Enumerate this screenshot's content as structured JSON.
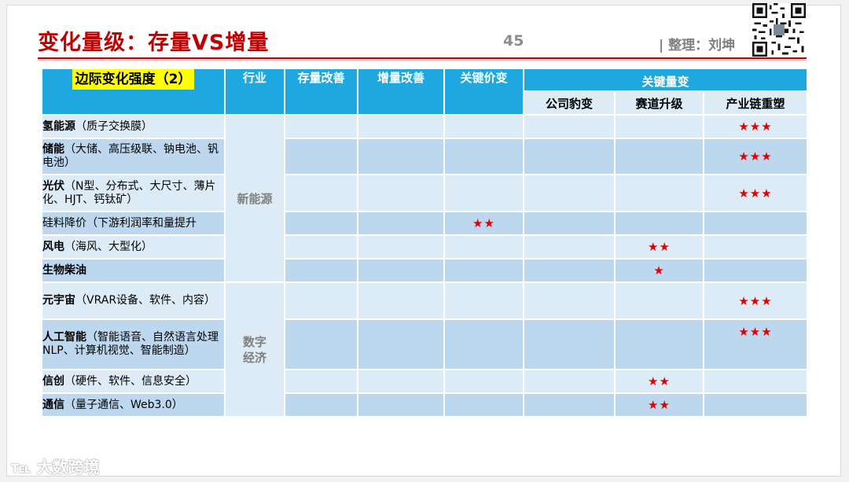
{
  "title": "变化量级：存量VS增量",
  "page_number": "45",
  "author": "|  整理：刘坤",
  "watermark": "大数跨境",
  "table": {
    "corner_label": "边际变化强度（2）",
    "headers": {
      "industry": "行业",
      "stock_improve": "存量改善",
      "incremental_improve": "增量改善",
      "key_price": "关键价变",
      "key_volume": "关键量变",
      "company_leap": "公司豹变",
      "track_upgrade": "赛道升级",
      "chain_reshape": "产业链重塑"
    },
    "groups": [
      {
        "name": "新能源"
      },
      {
        "name": "数字\n经济"
      }
    ],
    "rows": [
      {
        "name": "氢能源",
        "detail": "（质子交换膜）",
        "stock": "",
        "incr": "",
        "price": "",
        "leap": "",
        "track": "",
        "chain": "★★★"
      },
      {
        "name": "储能",
        "detail": "（大储、高压级联、钠电池、钒电池）",
        "stock": "",
        "incr": "",
        "price": "",
        "leap": "",
        "track": "",
        "chain": "★★★"
      },
      {
        "name": "光伏",
        "detail": "（N型、分布式、大尺寸、薄片化、HJT、钙钛矿）",
        "stock": "",
        "incr": "",
        "price": "",
        "leap": "",
        "track": "",
        "chain": "★★★"
      },
      {
        "name": "",
        "detail": "硅料降价（下游利润率和量提升",
        "stock": "",
        "incr": "",
        "price": "★★",
        "leap": "",
        "track": "",
        "chain": ""
      },
      {
        "name": "风电",
        "detail": "（海风、大型化）",
        "stock": "",
        "incr": "",
        "price": "",
        "leap": "",
        "track": "★★",
        "chain": ""
      },
      {
        "name": "生物柴油",
        "detail": "",
        "stock": "",
        "incr": "",
        "price": "",
        "leap": "",
        "track": "★",
        "chain": ""
      },
      {
        "name": "元宇宙",
        "detail": "（VRAR设备、软件、内容）",
        "stock": "",
        "incr": "",
        "price": "",
        "leap": "",
        "track": "",
        "chain": "★★★"
      },
      {
        "name": "人工智能",
        "detail": "（智能语音、自然语言处理NLP、计算机视觉、智能制造）",
        "stock": "",
        "incr": "",
        "price": "",
        "leap": "",
        "track": "",
        "chain": "★★★"
      },
      {
        "name": "信创",
        "detail": "（硬件、软件、信息安全）",
        "stock": "",
        "incr": "",
        "price": "",
        "leap": "",
        "track": "★★",
        "chain": ""
      },
      {
        "name": "通信",
        "detail": "（量子通信、Web3.0）",
        "stock": "",
        "incr": "",
        "price": "",
        "leap": "",
        "track": "★★",
        "chain": ""
      }
    ]
  }
}
